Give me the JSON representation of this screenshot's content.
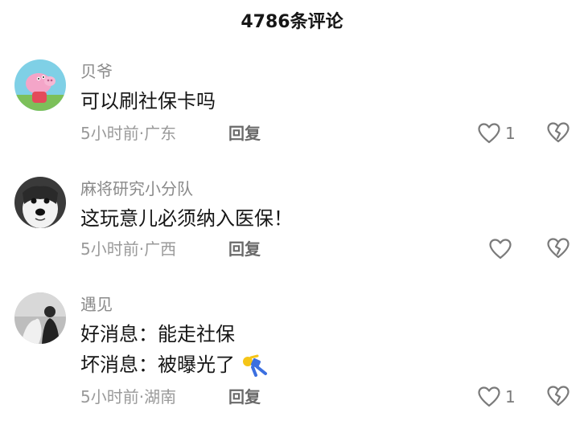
{
  "header": {
    "title": "4786条评论"
  },
  "comments": [
    {
      "username": "贝爷",
      "lines": [
        "可以刷社保卡吗"
      ],
      "time": "5小时前",
      "location": "广东",
      "reply_label": "回复",
      "like_count": "1",
      "avatar_icon": "pig-avatar-icon"
    },
    {
      "username": "麻将研究小分队",
      "lines": [
        "这玩意儿必须纳入医保！"
      ],
      "time": "5小时前",
      "location": "广西",
      "reply_label": "回复",
      "like_count": "",
      "avatar_icon": "dog-avatar-icon"
    },
    {
      "username": "遇见",
      "lines": [
        "好消息：能走社保",
        "坏消息：被曝光了"
      ],
      "time": "5小时前",
      "location": "湖南",
      "reply_label": "回复",
      "like_count": "1",
      "avatar_icon": "person-avatar-icon"
    }
  ],
  "meta_separator": "·",
  "colors": {
    "text": "#161616",
    "muted": "#9a9a9a",
    "icon": "#7a7a7a"
  }
}
